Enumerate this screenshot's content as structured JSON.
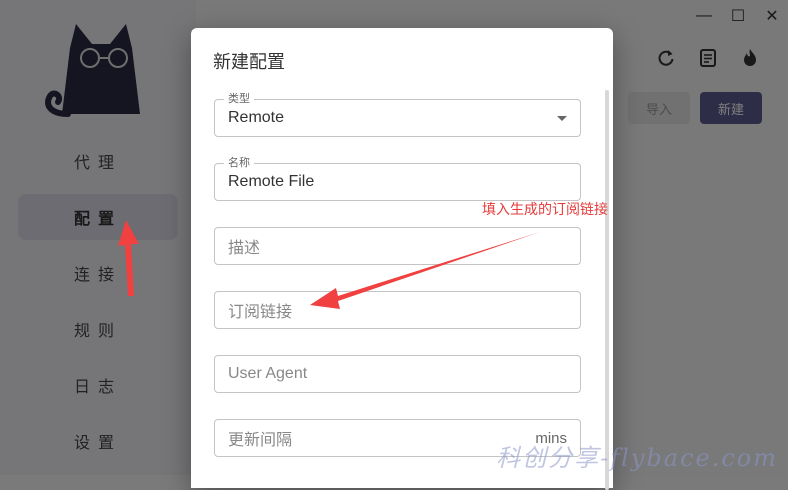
{
  "window_controls": {
    "minimize": "—",
    "maximize": "☐",
    "close": "✕"
  },
  "sidebar": {
    "items": [
      {
        "label": "代理"
      },
      {
        "label": "配置",
        "active": true
      },
      {
        "label": "连接"
      },
      {
        "label": "规则"
      },
      {
        "label": "日志"
      },
      {
        "label": "设置"
      }
    ]
  },
  "toolbar": {
    "import_label": "导入",
    "new_label": "新建"
  },
  "dialog": {
    "title": "新建配置",
    "type_field": {
      "label": "类型",
      "value": "Remote"
    },
    "name_field": {
      "label": "名称",
      "value": "Remote File"
    },
    "desc_field": {
      "placeholder": "描述"
    },
    "url_field": {
      "placeholder": "订阅链接"
    },
    "ua_field": {
      "placeholder": "User Agent"
    },
    "interval_field": {
      "placeholder": "更新间隔",
      "unit": "mins"
    }
  },
  "annotation": {
    "text": "填入生成的订阅链接",
    "color": "#e53b3b"
  },
  "watermark": {
    "text": "科创分享-flybace.com"
  },
  "colors": {
    "accent": "#5b5b8f",
    "arrow": "#f04040"
  }
}
